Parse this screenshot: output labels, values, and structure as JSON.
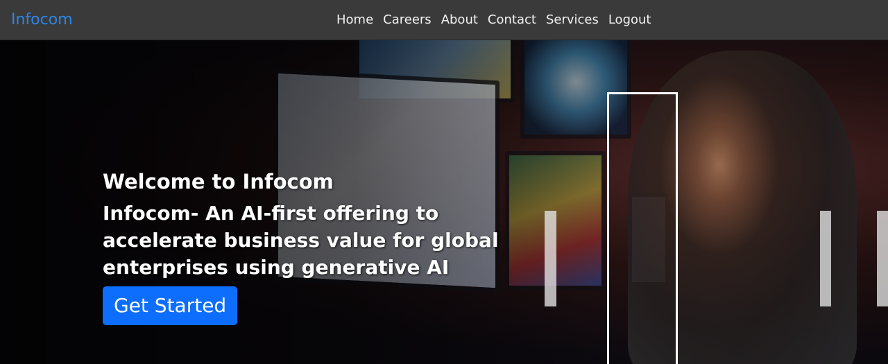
{
  "navbar": {
    "brand": "Infocom",
    "links": [
      "Home",
      "Careers",
      "About",
      "Contact",
      "Services",
      "Logout"
    ]
  },
  "hero": {
    "title": "Welcome to Infocom",
    "subtitle": "Infocom- An AI-first offering to accelerate business value for global enterprises using generative AI",
    "cta_label": "Get Started"
  },
  "colors": {
    "brand": "#2b86e8",
    "navbar_bg": "#3a3a3a",
    "cta_bg": "#0d6efd"
  }
}
